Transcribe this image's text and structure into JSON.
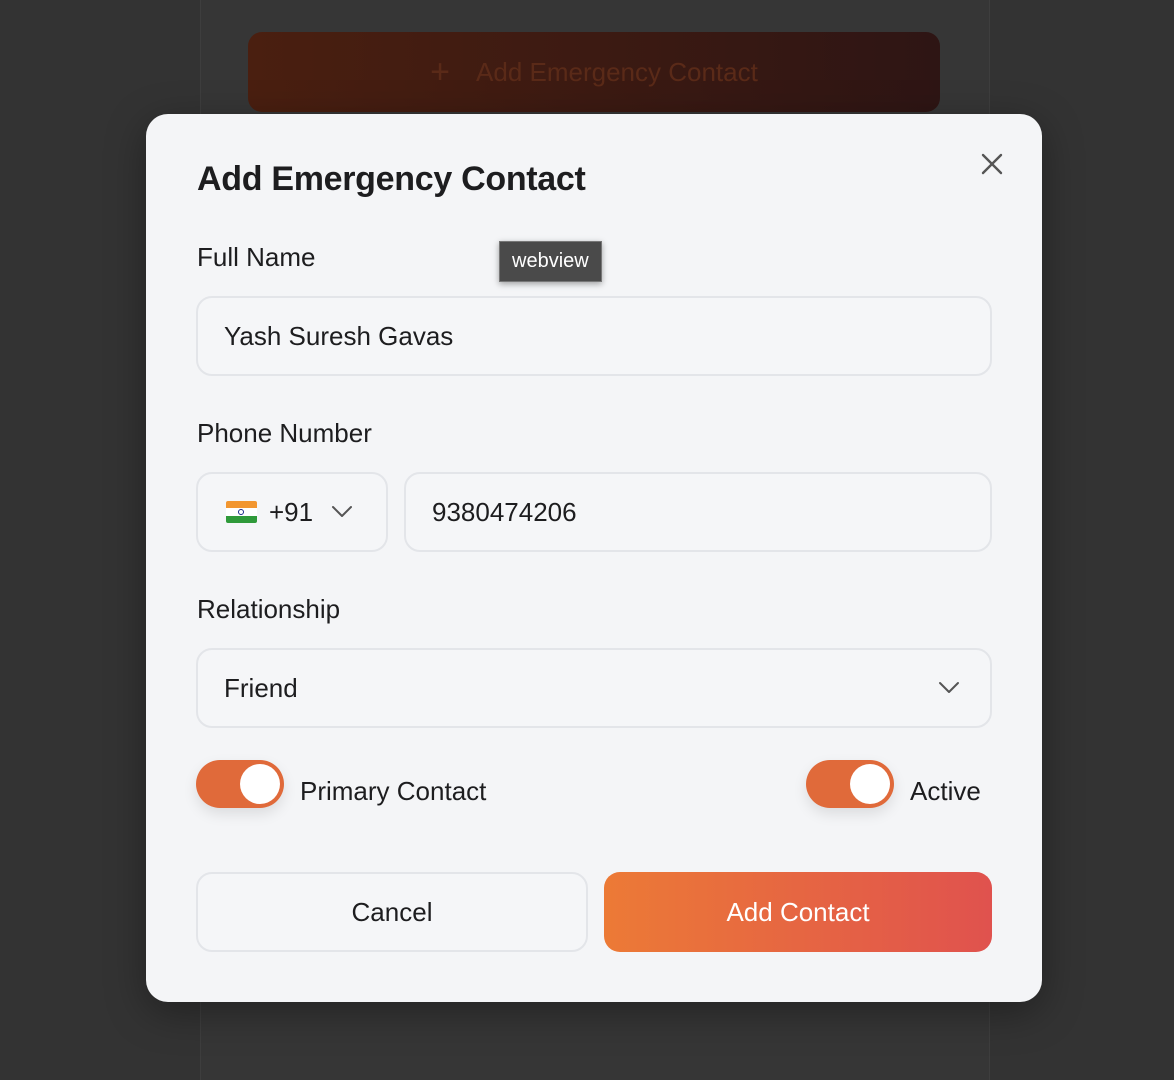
{
  "background": {
    "add_button_label": "Add Emergency Contact",
    "add_button_icon": "plus-icon"
  },
  "modal": {
    "title": "Add Emergency Contact",
    "close_icon": "close-icon",
    "tooltip": "webview",
    "full_name": {
      "label": "Full Name",
      "value": "Yash Suresh Gavas"
    },
    "phone": {
      "label": "Phone Number",
      "country_flag": "india-flag-icon",
      "country_code": "+91",
      "number": "9380474206"
    },
    "relationship": {
      "label": "Relationship",
      "selected": "Friend"
    },
    "toggles": {
      "primary_label": "Primary Contact",
      "primary_on": true,
      "active_label": "Active",
      "active_on": true
    },
    "actions": {
      "cancel_label": "Cancel",
      "submit_label": "Add Contact"
    }
  },
  "colors": {
    "accent": "#e06a3a",
    "gradient_start": "#ec7a36",
    "gradient_end": "#e0524e",
    "overlay": "#333333"
  }
}
